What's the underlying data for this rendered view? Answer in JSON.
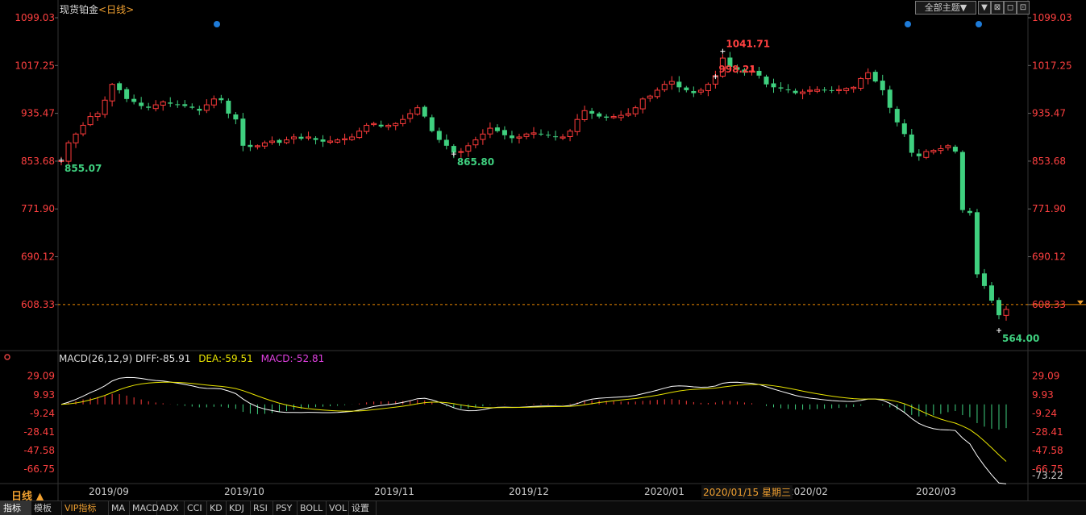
{
  "header": {
    "instrument": "现货铂金",
    "timeframe_tag": "<日线>",
    "theme_button": "全部主题▼"
  },
  "window_buttons": [
    "▼",
    "⊠",
    "◻",
    "⊡"
  ],
  "macd": {
    "label": "MACD(26,12,9)",
    "diff": "DIFF:-85.91",
    "dea": "DEA:-59.51",
    "hist": "MACD:-52.81"
  },
  "period_label": "日线 ▲",
  "crosshair_tip": "2020/01/15 星期三",
  "tabs": [
    "指标",
    "模板",
    "VIP指标",
    "MA",
    "MACD",
    "ADX",
    "CCI",
    "KD",
    "KDJ",
    "RSI",
    "PSY",
    "BOLL",
    "VOL",
    "设置"
  ],
  "chart_data": [
    {
      "type": "candlestick",
      "instrument": "现货铂金",
      "period": "日线",
      "y_ticks": [
        "1099.03",
        "1017.25",
        "935.47",
        "853.68",
        "771.90",
        "690.12",
        "608.33"
      ],
      "ylim": [
        564.0,
        1099.03
      ],
      "x_labels": [
        "2019/09",
        "2019/10",
        "2019/11",
        "2019/12",
        "2020/01",
        "2020/02",
        "2020/03"
      ],
      "reference_line": {
        "value": 608.33,
        "label": "608.33",
        "style": "dashed orange"
      },
      "annotations": [
        {
          "label": "998.21",
          "value": 998.21,
          "type": "local high"
        },
        {
          "label": "855.07",
          "value": 855.07,
          "type": "local low"
        },
        {
          "label": "865.80",
          "value": 865.8,
          "type": "local low"
        },
        {
          "label": "1041.71",
          "value": 1041.71,
          "type": "period high"
        },
        {
          "label": "564.00",
          "value": 564.0,
          "type": "period low"
        }
      ],
      "up_color": "#ff3b3b",
      "down_color": "#3fd07f",
      "closes": [
        855,
        885,
        900,
        915,
        930,
        935,
        958,
        985,
        975,
        960,
        955,
        948,
        945,
        950,
        955,
        952,
        950,
        948,
        945,
        940,
        950,
        960,
        958,
        935,
        925,
        880,
        878,
        880,
        885,
        888,
        885,
        890,
        895,
        892,
        895,
        890,
        887,
        888,
        890,
        892,
        895,
        905,
        915,
        918,
        913,
        915,
        918,
        925,
        935,
        945,
        930,
        905,
        890,
        880,
        868,
        870,
        880,
        890,
        900,
        910,
        905,
        898,
        893,
        895,
        900,
        902,
        900,
        898,
        895,
        895,
        905,
        925,
        940,
        935,
        930,
        928,
        930,
        932,
        935,
        945,
        960,
        965,
        975,
        985,
        990,
        980,
        975,
        970,
        975,
        985,
        1000,
        1030,
        1015,
        1010,
        1005,
        1008,
        1000,
        985,
        980,
        978,
        975,
        970,
        972,
        975,
        976,
        975,
        974,
        976,
        978,
        980,
        995,
        1005,
        990,
        975,
        945,
        920,
        900,
        868,
        862,
        870,
        872,
        875,
        880,
        870,
        770,
        765,
        660,
        640,
        615,
        590,
        600
      ],
      "macd_panel": {
        "y_ticks": [
          "29.09",
          "9.93",
          "-9.24",
          "-28.41",
          "-47.58",
          "-66.75",
          "-73.22"
        ],
        "ylim": [
          -80,
          38
        ],
        "latest": {
          "diff": -85.91,
          "dea": -59.51,
          "macd": -52.81
        },
        "line_colors": {
          "diff": "#ffffff",
          "dea": "#e8e400"
        }
      }
    }
  ]
}
